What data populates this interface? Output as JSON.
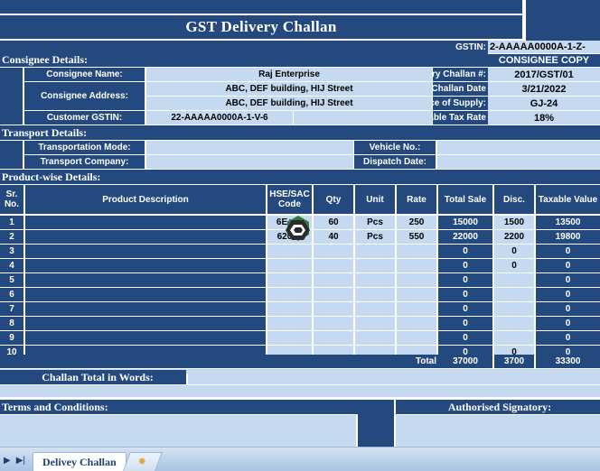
{
  "document": {
    "title": "GST Delivery Challan",
    "copy_marking": "CONSIGNEE COPY"
  },
  "header_right": {
    "gstin_label": "GSTIN:",
    "gstin_value": "2-AAAAA0000A-1-Z-",
    "delivery_challan_no_label": "Delivery Challan #:",
    "delivery_challan_no_value": "2017/GST/01",
    "delivery_challan_date_label": "elivey Challan Date",
    "delivery_challan_date_value": "3/21/2022",
    "place_of_supply_label": "Place of Supply:",
    "place_of_supply_value": "GJ-24",
    "applicable_tax_rate_label": "pplicable Tax Rate",
    "applicable_tax_rate_value": "18%"
  },
  "consignee": {
    "section_title": "Consignee Details:",
    "name_label": "Consignee Name:",
    "name_value": "Raj Enterprise",
    "address_label": "Consignee Address:",
    "address_line1": "ABC, DEF building, HIJ Street",
    "address_line2": "ABC, DEF building, HIJ Street",
    "gstin_label": "Customer GSTIN:",
    "gstin_value": "22-AAAAA0000A-1-V-6"
  },
  "transport": {
    "section_title": "Transport Details:",
    "mode_label": "Transportation Mode:",
    "mode_value": "",
    "company_label": "Transport Company:",
    "company_value": "",
    "vehicle_no_label": "Vehicle No.:",
    "vehicle_no_value": "",
    "dispatch_date_label": "Dispatch Date:",
    "dispatch_date_value": ""
  },
  "products": {
    "section_title": "Product-wise Details:",
    "columns": [
      "Sr. No.",
      "Product Description",
      "HSE/SAC Code",
      "Qty",
      "Unit",
      "Rate",
      "Total Sale",
      "Disc.",
      "Taxable Value"
    ],
    "rows": [
      {
        "sr": "1",
        "desc": "",
        "hsn": "6E+07",
        "qty": "60",
        "unit": "Pcs",
        "rate": "250",
        "total_sale": "15000",
        "disc": "1500",
        "taxable": "13500"
      },
      {
        "sr": "2",
        "desc": "",
        "hsn": "62000",
        "qty": "40",
        "unit": "Pcs",
        "rate": "550",
        "total_sale": "22000",
        "disc": "2200",
        "taxable": "19800"
      },
      {
        "sr": "3",
        "desc": "",
        "hsn": "",
        "qty": "",
        "unit": "",
        "rate": "",
        "total_sale": "0",
        "disc": "0",
        "taxable": "0"
      },
      {
        "sr": "4",
        "desc": "",
        "hsn": "",
        "qty": "",
        "unit": "",
        "rate": "",
        "total_sale": "0",
        "disc": "0",
        "taxable": "0"
      },
      {
        "sr": "5",
        "desc": "",
        "hsn": "",
        "qty": "",
        "unit": "",
        "rate": "",
        "total_sale": "0",
        "disc": "",
        "taxable": "0"
      },
      {
        "sr": "6",
        "desc": "",
        "hsn": "",
        "qty": "",
        "unit": "",
        "rate": "",
        "total_sale": "0",
        "disc": "",
        "taxable": "0"
      },
      {
        "sr": "7",
        "desc": "",
        "hsn": "",
        "qty": "",
        "unit": "",
        "rate": "",
        "total_sale": "0",
        "disc": "",
        "taxable": "0"
      },
      {
        "sr": "8",
        "desc": "",
        "hsn": "",
        "qty": "",
        "unit": "",
        "rate": "",
        "total_sale": "0",
        "disc": "",
        "taxable": "0"
      },
      {
        "sr": "9",
        "desc": "",
        "hsn": "",
        "qty": "",
        "unit": "",
        "rate": "",
        "total_sale": "0",
        "disc": "",
        "taxable": "0"
      },
      {
        "sr": "10",
        "desc": "",
        "hsn": "",
        "qty": "",
        "unit": "",
        "rate": "",
        "total_sale": "0",
        "disc": "0",
        "taxable": "0"
      }
    ],
    "total_label": "Total",
    "total_sale": "37000",
    "total_disc": "3700",
    "total_taxable": "33300"
  },
  "footer": {
    "challan_total_words_label": "Challan Total in Words:",
    "challan_total_words_value": "",
    "terms_label": "Terms and Conditions:",
    "terms_value": "",
    "signatory_label": "Authorised Signatory:",
    "signatory_value": ""
  },
  "tabbar": {
    "first_arrow": "▶",
    "last_arrow": "▶|",
    "sheet_name": "Delivey Challan",
    "new_sheet_glyph": "✸"
  },
  "colors": {
    "navy": "#24497e",
    "light_blue": "#c5d9f1",
    "white": "#ffffff",
    "cursor_accent": "#2f7a43"
  }
}
